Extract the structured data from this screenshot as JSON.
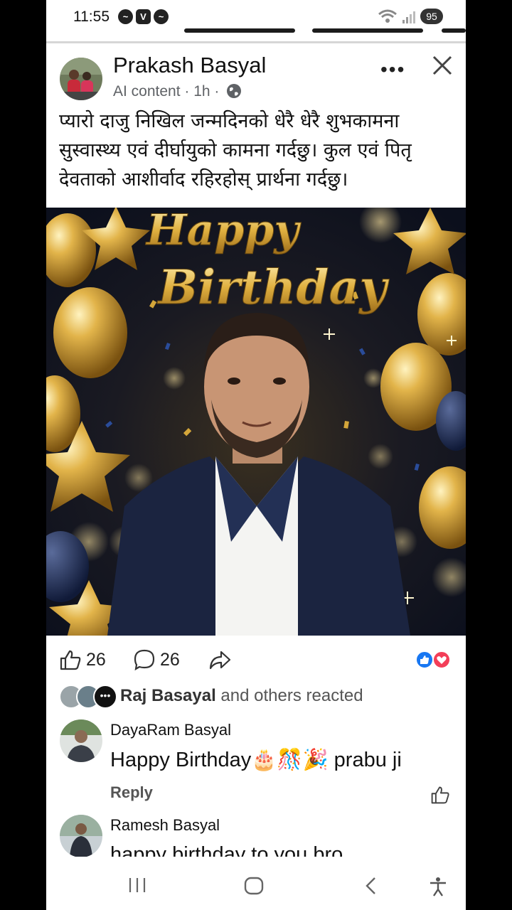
{
  "status_bar": {
    "time": "11:55",
    "battery": "95",
    "notif_icons": [
      "messenger-icon",
      "v-app-icon",
      "messenger-icon"
    ]
  },
  "post": {
    "author": "Prakash Basyal",
    "meta": "AI content · 1h ·",
    "caption": "प्यारो दाजु निखिल जन्मदिनको धेरै धेरै शुभकामना सुस्वास्थ्य एवं दीर्घायुको कामना गर्दछु। कुल एवं पितृ देवताको आशीर्वाद रहिरहोस् प्रार्थना गर्दछु।",
    "image": {
      "heading_line1": "Happy",
      "heading_line2": "Birthday"
    }
  },
  "reactions": {
    "likes": "26",
    "comments": "26",
    "summary_name": "Raj Basayal",
    "summary_rest": " and others reacted",
    "colors": {
      "like": "#1877f2",
      "love": "#f33e58"
    }
  },
  "comments": [
    {
      "author": "DayaRam Basyal",
      "text": "Happy Birthday🎂🎊🎉 prabu ji",
      "reply": "Reply"
    },
    {
      "author": "Ramesh Basyal",
      "text": "happy birthday to you  bro"
    }
  ],
  "nav": [
    "recent-apps-icon",
    "home-icon",
    "back-icon",
    "accessibility-icon"
  ]
}
